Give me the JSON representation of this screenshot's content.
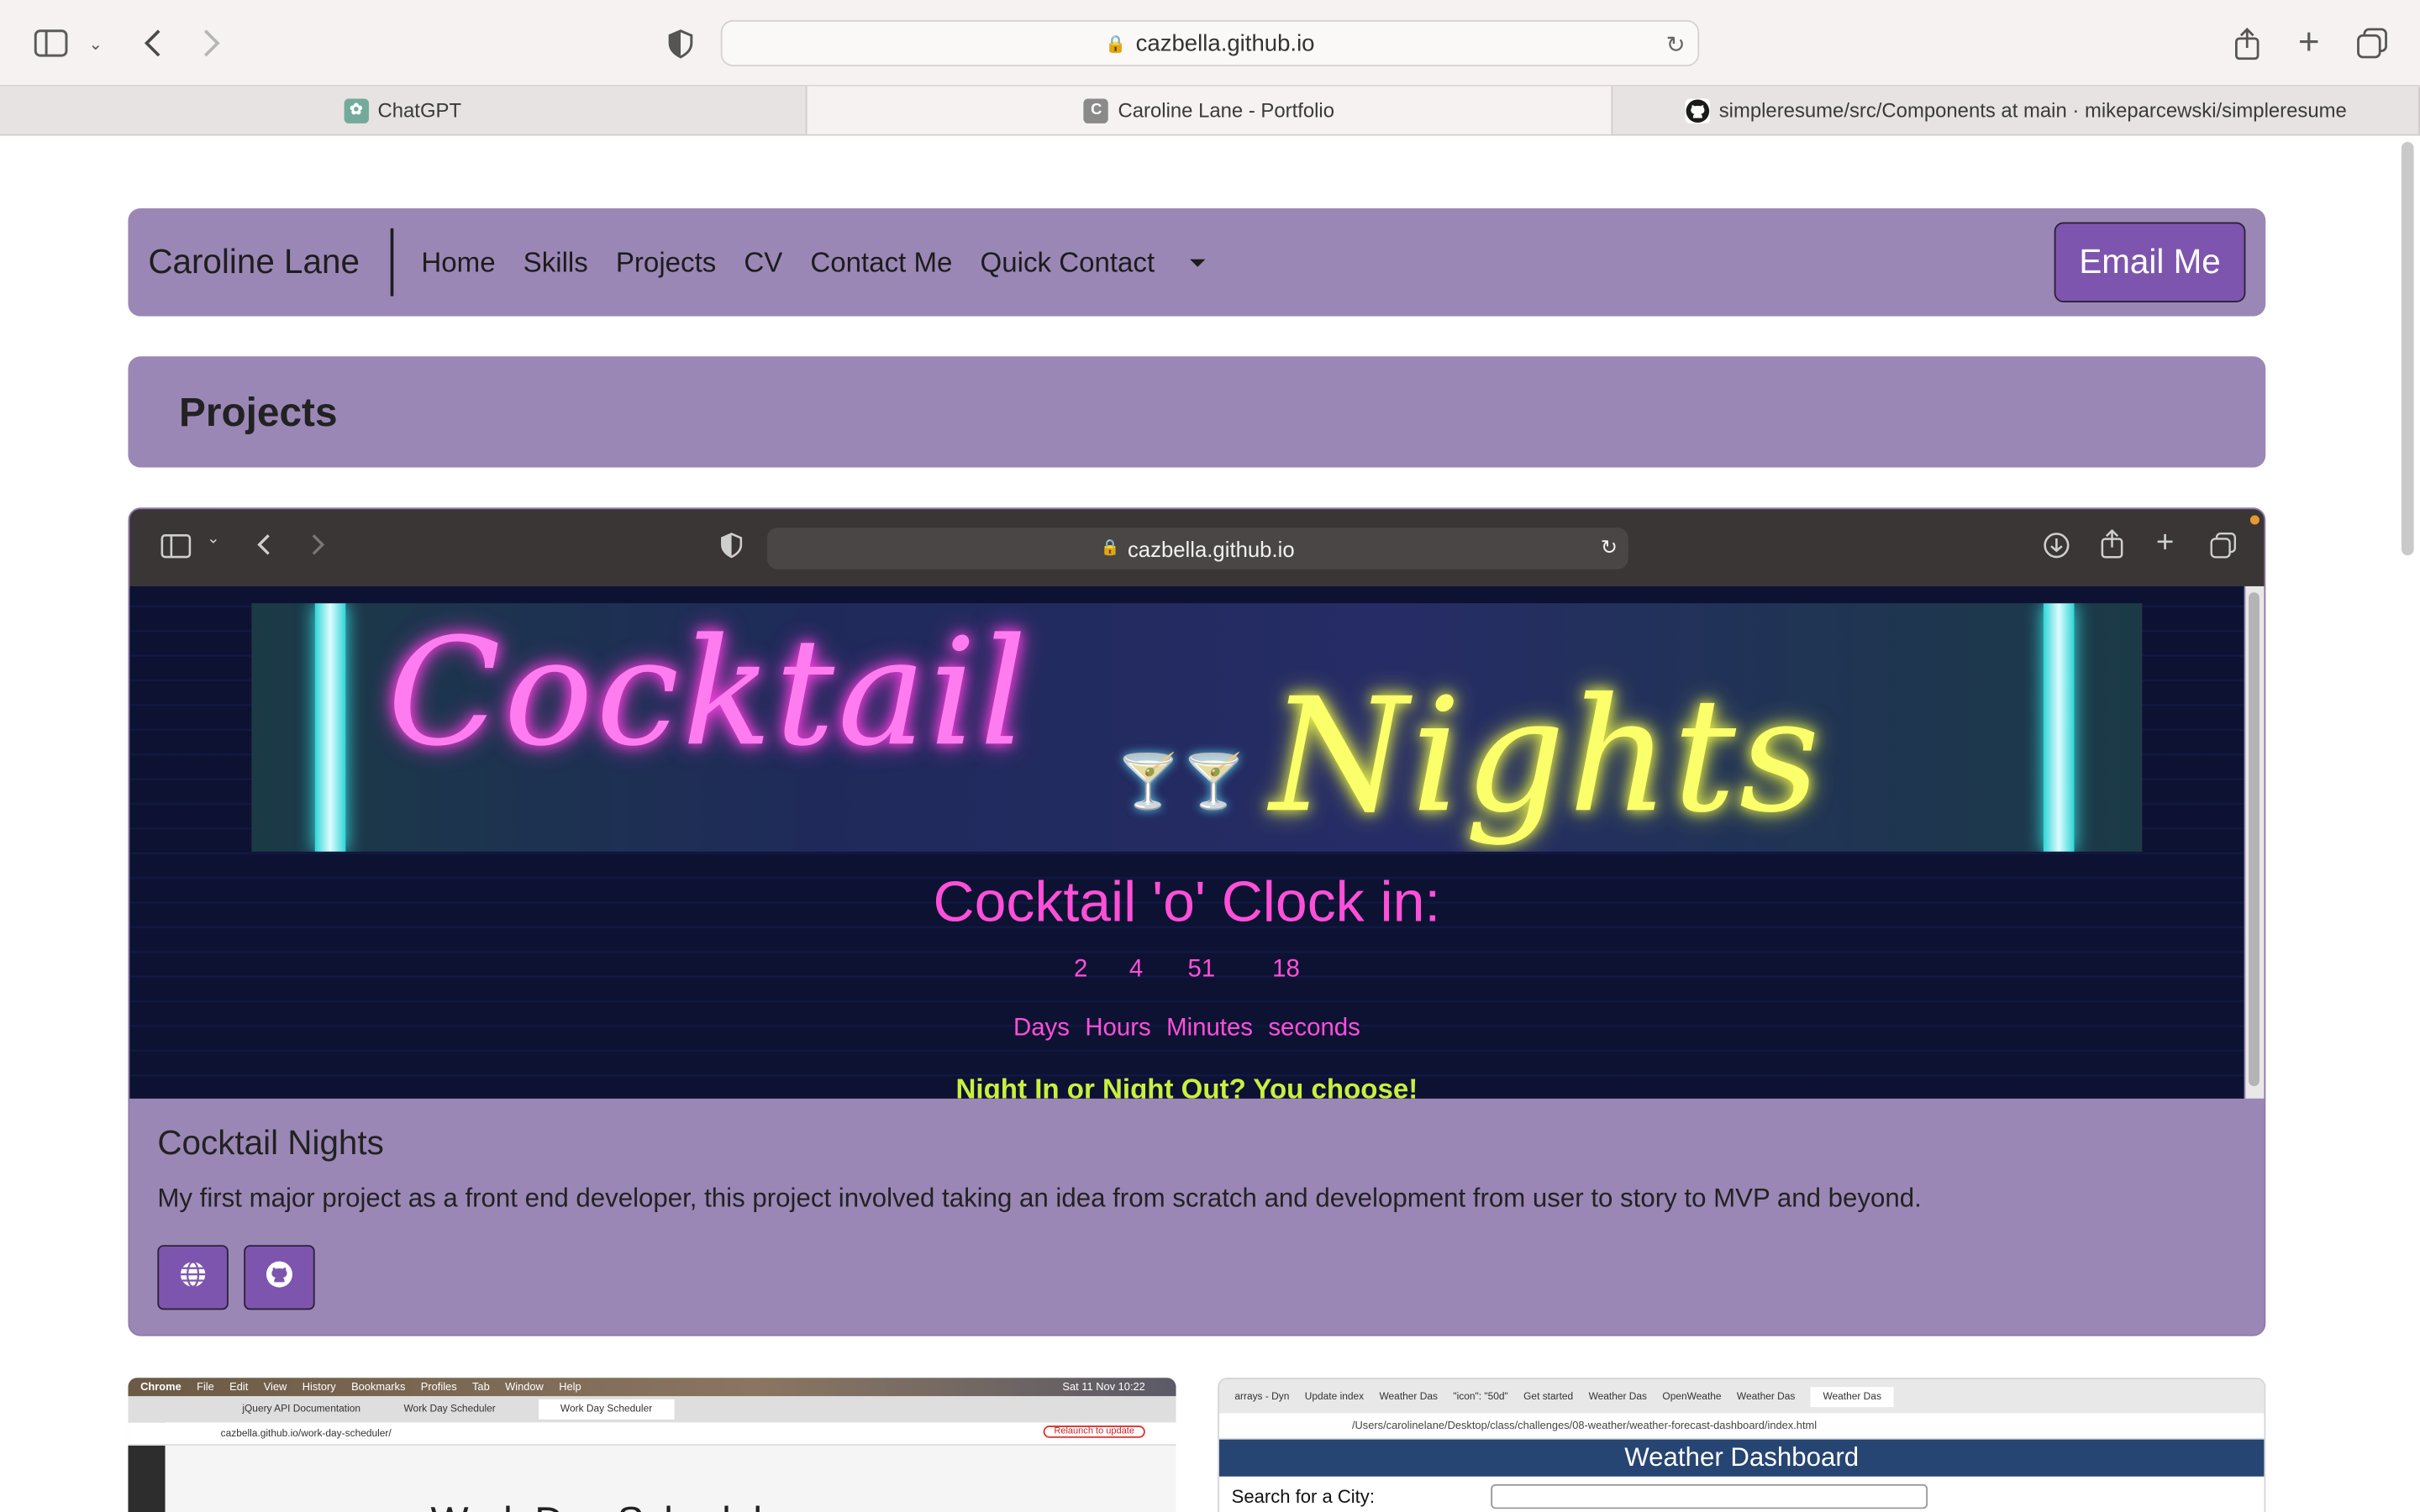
{
  "browser": {
    "url": "cazbella.github.io",
    "tabs": [
      {
        "label": "ChatGPT",
        "icon": "chatgpt-icon",
        "active": false
      },
      {
        "label": "Caroline Lane - Portfolio",
        "icon": "c-letter-icon",
        "active": true
      },
      {
        "label": "simpleresume/src/Components at main · mikeparcewski/simpleresume",
        "icon": "github-icon",
        "active": false
      }
    ]
  },
  "nav": {
    "brand": "Caroline Lane",
    "links": [
      "Home",
      "Skills",
      "Projects",
      "CV",
      "Contact Me"
    ],
    "dropdown": "Quick Contact",
    "email_button": "Email Me"
  },
  "section": {
    "title": "Projects"
  },
  "project": {
    "inner_url": "cazbella.github.io",
    "banner_word1": "Cocktail",
    "banner_word2": "Nights",
    "clock_title": "Cocktail 'o' Clock in:",
    "counts": [
      "2",
      "4",
      "51",
      "18"
    ],
    "count_labels": [
      "Days",
      "Hours",
      "Minutes",
      "seconds"
    ],
    "tagline": "Night In or Night Out? You choose!",
    "title": "Cocktail Nights",
    "description": "My first major project as a front end developer, this project involved taking an idea from scratch and development from user to story to MVP and beyond."
  },
  "mini_left": {
    "menu": [
      "Chrome",
      "File",
      "Edit",
      "View",
      "History",
      "Bookmarks",
      "Profiles",
      "Tab",
      "Window",
      "Help"
    ],
    "clock": "Sat 11 Nov 10:22",
    "tabs": [
      "jQuery API Documentation",
      "Work Day Scheduler",
      "Work Day Scheduler"
    ],
    "url": "cazbella.github.io/work-day-scheduler/",
    "relaunch": "Relaunch to update",
    "heading": "Work Day Scheduler"
  },
  "mini_right": {
    "tabs": [
      "arrays - Dyn",
      "Update index",
      "Weather Das",
      "\"icon\": \"50d\"",
      "Get started",
      "Weather Das",
      "OpenWeathe",
      "Weather Das",
      "Weather Das"
    ],
    "url": "/Users/carolinelane/Desktop/class/challenges/08-weather/weather-forecast-dashboard/index.html",
    "header": "Weather Dashboard",
    "search_label": "Search for a City:"
  },
  "colors": {
    "nav_bg": "#9b87b6",
    "button_bg": "#7d55ae",
    "neon_pink": "#ff4fd8",
    "neon_yellow": "#fbff6a"
  }
}
